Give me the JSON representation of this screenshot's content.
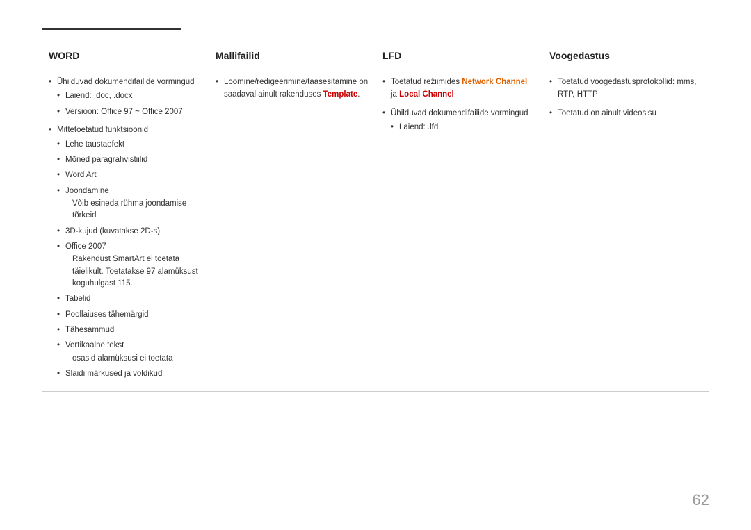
{
  "page": {
    "number": "62"
  },
  "table": {
    "headers": [
      "WORD",
      "Mallifailid",
      "LFD",
      "Voogedastus"
    ],
    "columns": {
      "word": {
        "bullet1": "Ühilduvad dokumendifailide vormingud",
        "sub1_1": "Laiend: .doc, .docx",
        "sub1_2": "Versioon: Office 97 ~ Office 2007",
        "bullet2": "Mittetoetatud funktsioonid",
        "sub2_1": "Lehe taustaefekt",
        "sub2_2": "Mõned paragrahvistiilid",
        "sub2_3": "Word Art",
        "sub2_4": "Joondamine",
        "sub2_4_note": "Võib esineda rühma joondamise tõrkeid",
        "sub2_5": "3D-kujud (kuvatakse 2D-s)",
        "sub2_6": "Office 2007",
        "sub2_6_note": "Rakendust SmartArt ei toetata täielikult. Toetatakse 97 alamüksust koguhulgast 115.",
        "sub2_7": "Tabelid",
        "sub2_8": "Poollaiuses tähemärgid",
        "sub2_9": "Tähesammud",
        "sub2_10": "Vertikaalne tekst",
        "sub2_10_note": "osasid alamüksusi ei toetata",
        "sub2_11": "Slaidi märkused ja voldikud"
      },
      "mallifailid": {
        "bullet1_pre": "Loomine/redigeerimine/taasesitamine on saadaval ainult rakenduses ",
        "template_word": "Template",
        "bullet1_post": "."
      },
      "lfd": {
        "bullet1_pre": "Toetatud režiimides ",
        "network_channel": "Network Channel",
        "ja": " ja ",
        "local_channel": "Local Channel",
        "bullet2": "Ühilduvad dokumendifailide vormingud",
        "sub2_1": "Laiend: .lfd"
      },
      "voogedastus": {
        "bullet1": "Toetatud voogedastusprotokollid: mms, RTP, HTTP",
        "bullet2": "Toetatud on ainult videosisu"
      }
    }
  }
}
